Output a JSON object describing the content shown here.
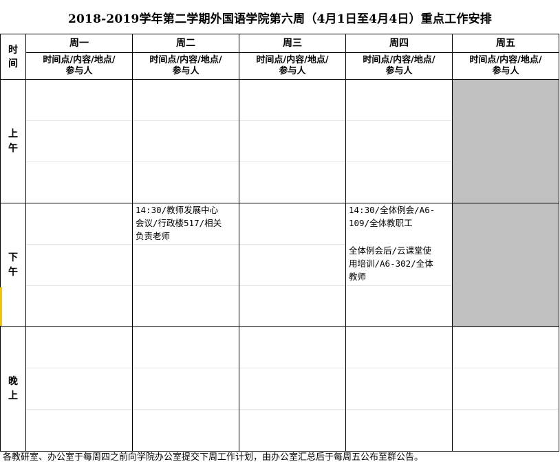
{
  "title": "2018-2019学年第二学期外国语学院第六周（4月1日至4月4日）重点工作安排",
  "time_header": "时\n间",
  "days": [
    "周一",
    "周二",
    "周三",
    "周四",
    "周五"
  ],
  "subheader": "时间点/内容/地点/\n参与人",
  "periods": [
    "上\n午",
    "下\n午",
    "晚\n上"
  ],
  "entries": {
    "afternoon_tue": "14:30/教师发展中心\n会议/行政楼517/相关\n负责老师",
    "afternoon_thu_1": "14:30/全体例会/A6-\n109/全体教职工",
    "afternoon_thu_2": "全体例会后/云课堂使\n用培训/A6-302/全体\n教师"
  },
  "footer": "各教研室、办公室于每周四之前向学院办公室提交下周工作计划，由办公室汇总后于每周五公布至群公告。",
  "colors": {
    "grey_cell": "#c0c0c0",
    "border": "#000000",
    "marker": "#f5c400"
  }
}
